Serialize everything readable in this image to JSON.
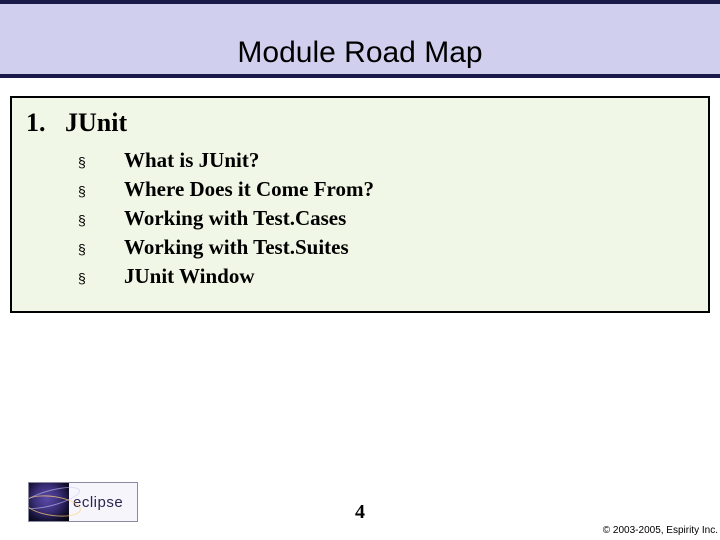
{
  "title": "Module Road Map",
  "section": {
    "number": "1.",
    "label": "JUnit"
  },
  "bullets": [
    "What is JUnit?",
    "Where Does it Come From?",
    "Working with Test.Cases",
    "Working with Test.Suites",
    "JUnit Window"
  ],
  "logo_text": "eclipse",
  "page_number": "4",
  "copyright": "© 2003-2005, Espirity Inc."
}
